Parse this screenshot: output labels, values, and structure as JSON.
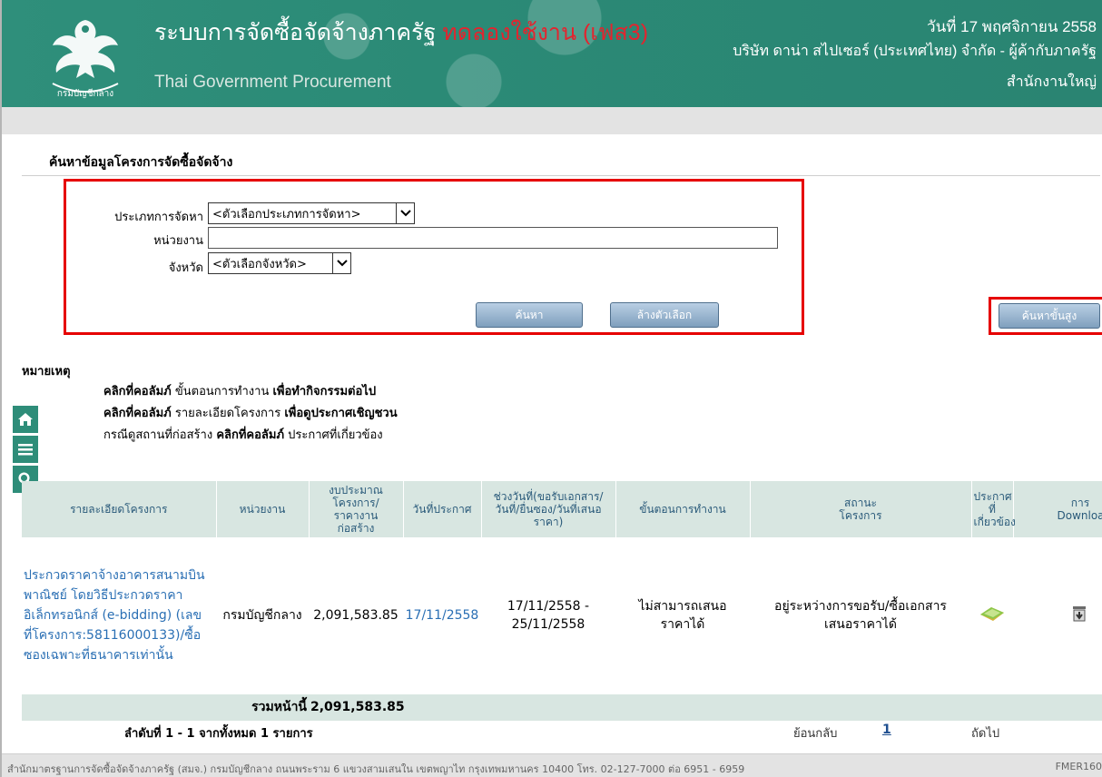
{
  "header": {
    "system_title": "ระบบการจัดซื้อจัดจ้างภาครัฐ",
    "trial_label": "ทดลองใช้งาน (เฟส3)",
    "subtitle": "Thai Government Procurement",
    "date": "วันที่ 17 พฤศจิกายน 2558",
    "company": "บริษัท ดาน่า สไปเซอร์ (ประเทศไทย) จำกัด - ผู้ค้ากับภาครัฐ",
    "branch": "สำนักงานใหญ่",
    "logo_text": "กรมบัญชีกลาง"
  },
  "search": {
    "title": "ค้นหาข้อมูลโครงการจัดซื้อจัดจ้าง",
    "method_label": "ประเภทการจัดหา",
    "method_value": "<ตัวเลือกประเภทการจัดหา>",
    "unit_label": "หน่วยงาน",
    "unit_value": "",
    "province_label": "จังหวัด",
    "province_value": "<ตัวเลือกจังหวัด>",
    "search_button": "ค้นหา",
    "clear_button": "ล้างตัวเลือก",
    "advanced_button": "ค้นหาขั้นสูง"
  },
  "notes": {
    "title": "หมายเหตุ",
    "line1_a": "คลิกที่คอลัมภ์",
    "line1_b": "ขั้นตอนการทำงาน",
    "line1_c": "เพื่อทำกิจกรรมต่อไป",
    "line2_a": "คลิกที่คอลัมภ์",
    "line2_b": "รายละเอียดโครงการ",
    "line2_c": "เพื่อดูประกาศเชิญชวน",
    "line3_a": "กรณีดูสถานที่ก่อสร้าง",
    "line3_b": "คลิกที่คอลัมภ์",
    "line3_c": "ประกาศที่เกี่ยวข้อง"
  },
  "sidenav": {
    "icons": [
      "home-icon",
      "menu-icon",
      "search-icon"
    ]
  },
  "table": {
    "headers": {
      "detail": "รายละเอียดโครงการ",
      "unit": "หน่วยงาน",
      "budget": "งบประมาณโครงการ/ราคางานก่อสร้าง",
      "announce_date": "วันที่ประกาศ",
      "period": "ช่วงวันที่(ขอรับเอกสาร/วันที่/ยื่นซอง/วันที่เสนอราคา)",
      "step": "ขั้นตอนการทำงาน",
      "status": "สถานะโครงการ",
      "related": "ประกาศที่เกี่ยวข้อง",
      "download": "การ Download"
    },
    "rows": [
      {
        "detail": "ประกวดราคาจ้างอาคารสนามบินพาณิชย์ โดยวิธีประกวดราคาอิเล็กทรอนิกส์ (e-bidding) (เลขที่โครงการ:58116000133)/ซื้อซองเฉพาะที่ธนาคารเท่านั้น",
        "unit": "กรมบัญชีกลาง",
        "budget": "2,091,583.85",
        "announce_date": "17/11/2558",
        "period": "17/11/2558 - 25/11/2558",
        "step": "ไม่สามารถเสนอราคาได้",
        "status": "อยู่ระหว่างการขอรับ/ซื้อเอกสารเสนอราคาได้"
      }
    ],
    "total_label": "รวมหน้านี้",
    "total_value": "2,091,583.85"
  },
  "pagination": {
    "summary_a": "ลำดับที่",
    "summary_range": "1 - 1",
    "summary_b": "จากทั้งหมด",
    "summary_total": "1",
    "summary_c": "รายการ",
    "back": "ย้อนกลับ",
    "page": "1",
    "next": "ถัดไป"
  },
  "footer": {
    "text": "สำนักมาตรฐานการจัดซื้อจัดจ้างภาครัฐ (สมจ.) กรมบัญชีกลาง ถนนพระราม 6 แขวงสามเสนใน เขตพญาไท กรุงเทพมหานคร 10400 โทร. 02-127-7000 ต่อ 6951 - 6959",
    "code": "FMER160"
  },
  "colors": {
    "header_green": "#2b8a76",
    "highlight_red": "#e60000",
    "table_header_bg": "#d8e6e1",
    "link_blue": "#2a6fb4"
  }
}
